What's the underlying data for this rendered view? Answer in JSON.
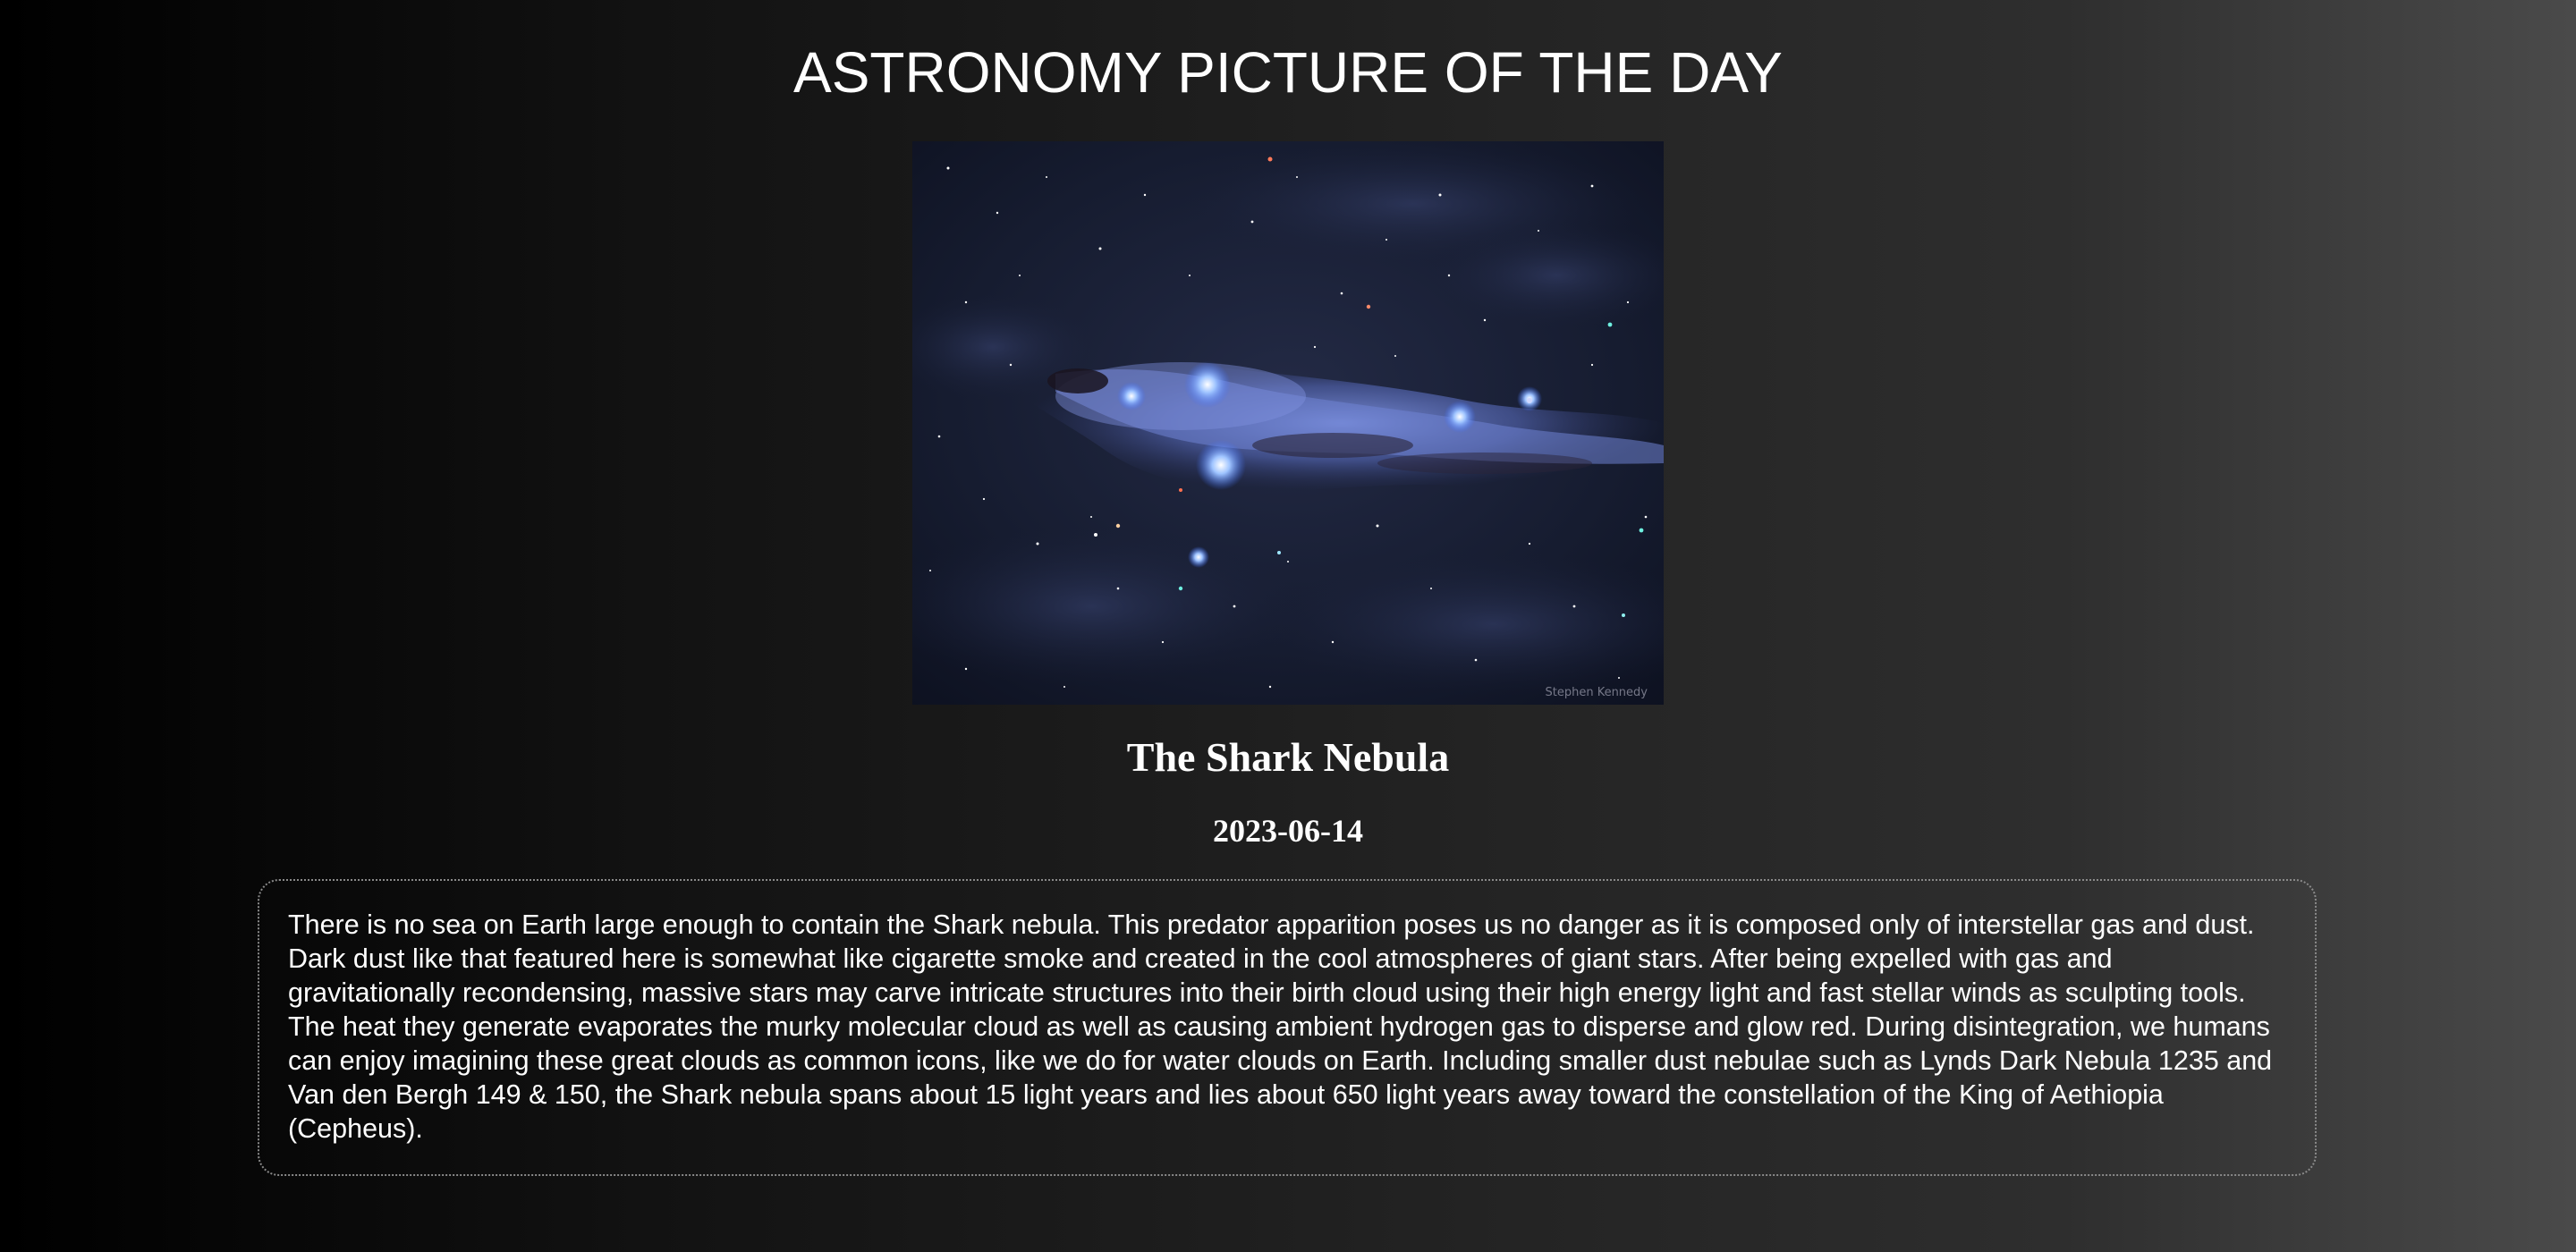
{
  "header": {
    "title": "ASTRONOMY PICTURE OF THE DAY"
  },
  "picture": {
    "alt": "The Shark Nebula",
    "credit": "Stephen Kennedy",
    "title": "The Shark Nebula",
    "date": "2023-06-14",
    "explanation": "There is no sea on Earth large enough to contain the Shark nebula. This predator apparition poses us no danger as it is composed only of interstellar gas and dust. Dark dust like that featured here is somewhat like cigarette smoke and created in the cool atmospheres of giant stars. After being expelled with gas and gravitationally recondensing, massive stars may carve intricate structures into their birth cloud using their high energy light and fast stellar winds as sculpting tools. The heat they generate evaporates the murky molecular cloud as well as causing ambient hydrogen gas to disperse and glow red. During disintegration, we humans can enjoy imagining these great clouds as common icons, like we do for water clouds on Earth. Including smaller dust nebulae such as Lynds Dark Nebula 1235 and Van den Bergh 149 & 150, the Shark nebula spans about 15 light years and lies about 650 light years away toward the constellation of the King of Aethiopia (Cepheus)."
  },
  "colors": {
    "background_dark": "#000000",
    "background_light": "#4a4a4a",
    "text": "#ffffff",
    "box_border": "#8a8a8a",
    "nebula_blue": "#5a6fc0",
    "space": "#141a2c"
  }
}
